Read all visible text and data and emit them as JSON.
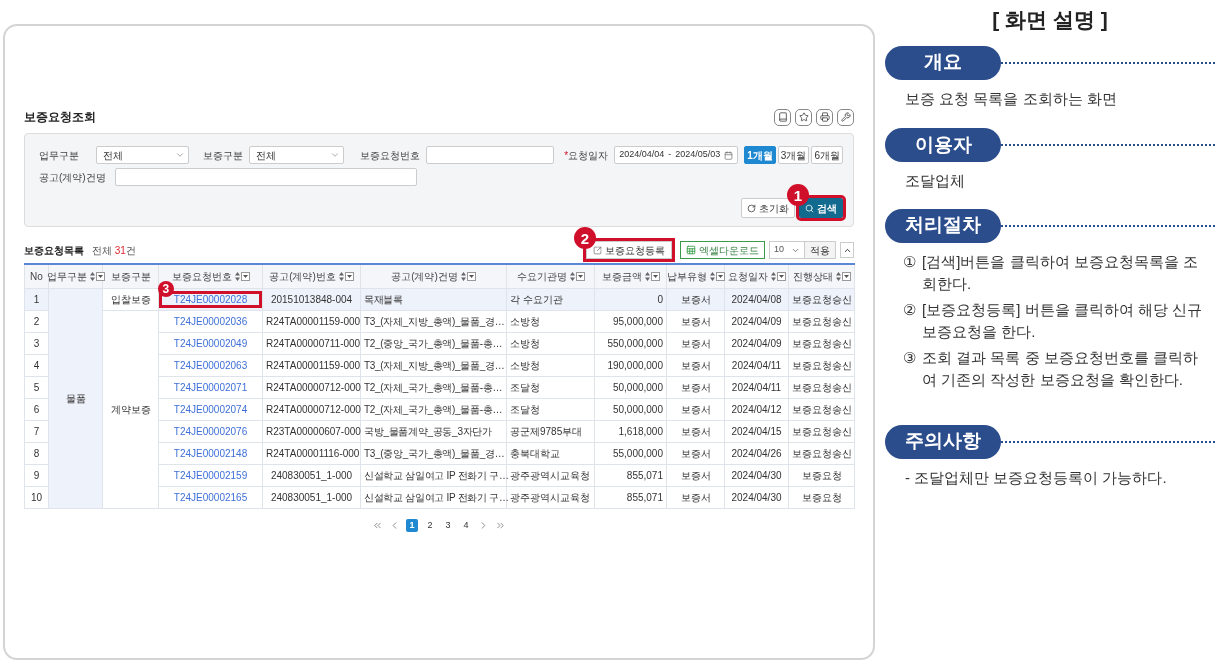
{
  "screen": {
    "title": "보증요청조회",
    "toolbar": [
      {
        "kind": "manual"
      },
      {
        "kind": "favorite"
      },
      {
        "kind": "print"
      },
      {
        "kind": "settings"
      }
    ],
    "filters": {
      "business": {
        "label": "업무구분",
        "value": "전체"
      },
      "guarantee": {
        "label": "보증구분",
        "value": "전체"
      },
      "request_no": {
        "label": "보증요청번호"
      },
      "date": {
        "required_mark": "*",
        "label": "요청일자",
        "from": "2024/04/04",
        "separator": "-",
        "to": "2024/05/03"
      },
      "periods": [
        {
          "label": "1개월",
          "selected": true
        },
        {
          "label": "3개월",
          "selected": false
        },
        {
          "label": "6개월",
          "selected": false
        }
      ],
      "notice_name": {
        "label": "공고(계약)건명"
      },
      "reset_button": "초기화",
      "search_button": {
        "label": "검색",
        "callout": "1"
      }
    },
    "list": {
      "title": "보증요청목록",
      "total_label": "전체",
      "total_count": "31",
      "total_unit": "건",
      "register_button": {
        "label": "보증요청등록",
        "callout": "2"
      },
      "excel_button": "엑셀다운로드",
      "page_size": "10",
      "apply_button": "적용"
    },
    "table": {
      "columns": [
        {
          "label": "No",
          "sortable": false
        },
        {
          "label": "업무구분",
          "sortable": true
        },
        {
          "label": "보증구분",
          "sortable": false
        },
        {
          "label": "보증요청번호",
          "sortable": true
        },
        {
          "label": "공고(계약)번호",
          "sortable": true
        },
        {
          "label": "공고(계약)건명",
          "sortable": true
        },
        {
          "label": "수요기관명",
          "sortable": true
        },
        {
          "label": "보증금액",
          "sortable": true
        },
        {
          "label": "납부유형",
          "sortable": true
        },
        {
          "label": "요청일자",
          "sortable": true
        },
        {
          "label": "진행상태",
          "sortable": true
        }
      ],
      "groups": [
        {
          "business": "물품",
          "subgroups": [
            {
              "guarantee": "입찰보증",
              "rows": [
                {
                  "no": "1",
                  "request_no": "T24JE00002028",
                  "callout": "3",
                  "notice_no": "20151013848-004",
                  "notice_name": "목재블록",
                  "agency": "각 수요기관",
                  "amount": "0",
                  "payment": "보증서",
                  "date": "2024/04/08",
                  "status": "보증요청승신",
                  "selected": true
                }
              ]
            },
            {
              "guarantee": "계약보증",
              "rows": [
                {
                  "no": "2",
                  "request_no": "T24JE00002036",
                  "notice_no": "R24TA00001159-000",
                  "notice_name": "T3_(자체_지방_총액)_물품_경…",
                  "agency": "소방청",
                  "amount": "95,000,000",
                  "payment": "보증서",
                  "date": "2024/04/09",
                  "status": "보증요청송신",
                  "selected": false
                },
                {
                  "no": "3",
                  "request_no": "T24JE00002049",
                  "notice_no": "R24TA00000711-000",
                  "notice_name": "T2_(중앙_국가_총액)_물품-총…",
                  "agency": "소방청",
                  "amount": "550,000,000",
                  "payment": "보증서",
                  "date": "2024/04/09",
                  "status": "보증요청송신",
                  "selected": false
                },
                {
                  "no": "4",
                  "request_no": "T24JE00002063",
                  "notice_no": "R24TA00001159-000",
                  "notice_name": "T3_(자체_지방_총액)_물품_경…",
                  "agency": "소방청",
                  "amount": "190,000,000",
                  "payment": "보증서",
                  "date": "2024/04/11",
                  "status": "보증요청송신",
                  "selected": false
                },
                {
                  "no": "5",
                  "request_no": "T24JE00002071",
                  "notice_no": "R24TA00000712-000",
                  "notice_name": "T2_(자체_국가_총액)_물품-총…",
                  "agency": "조달청",
                  "amount": "50,000,000",
                  "payment": "보증서",
                  "date": "2024/04/11",
                  "status": "보증요청송신",
                  "selected": false
                },
                {
                  "no": "6",
                  "request_no": "T24JE00002074",
                  "notice_no": "R24TA00000712-000",
                  "notice_name": "T2_(자체_국가_총액)_물품-총…",
                  "agency": "조달청",
                  "amount": "50,000,000",
                  "payment": "보증서",
                  "date": "2024/04/12",
                  "status": "보증요청송신",
                  "selected": false
                },
                {
                  "no": "7",
                  "request_no": "T24JE00002076",
                  "notice_no": "R23TA00000607-000",
                  "notice_name": "국방_물품계약_공동_3자단가",
                  "agency": "공군제9785부대",
                  "amount": "1,618,000",
                  "payment": "보증서",
                  "date": "2024/04/15",
                  "status": "보증요청송신",
                  "selected": false
                },
                {
                  "no": "8",
                  "request_no": "T24JE00002148",
                  "notice_no": "R24TA00001116-000",
                  "notice_name": "T3_(중앙_국가_총액)_물품_경…",
                  "agency": "충북대학교",
                  "amount": "55,000,000",
                  "payment": "보증서",
                  "date": "2024/04/26",
                  "status": "보증요청송신",
                  "selected": false
                },
                {
                  "no": "9",
                  "request_no": "T24JE00002159",
                  "notice_no": "240830051_1-000",
                  "notice_name": "신설학교 삼일여고 IP 전화기 구…",
                  "agency": "광주광역시교육청",
                  "amount": "855,071",
                  "payment": "보증서",
                  "date": "2024/04/30",
                  "status": "보증요청",
                  "selected": false
                },
                {
                  "no": "10",
                  "request_no": "T24JE00002165",
                  "notice_no": "240830051_1-000",
                  "notice_name": "신설학교 삼일여고 IP 전화기 구…",
                  "agency": "광주광역시교육청",
                  "amount": "855,071",
                  "payment": "보증서",
                  "date": "2024/04/30",
                  "status": "보증요청",
                  "selected": false
                }
              ]
            }
          ]
        }
      ]
    },
    "pagination": [
      {
        "label": "1",
        "selected": true
      },
      {
        "label": "2",
        "selected": false
      },
      {
        "label": "3",
        "selected": false
      },
      {
        "label": "4",
        "selected": false
      }
    ]
  },
  "guide": {
    "title": "[ 화면 설명 ]",
    "sections": [
      {
        "kind": "text",
        "heading": "개요",
        "text": "보증 요청 목록을 조회하는 화면"
      },
      {
        "kind": "text",
        "heading": "이용자",
        "text": "조달업체"
      },
      {
        "kind": "steps",
        "heading": "처리절차",
        "steps": [
          {
            "marker": "①",
            "text": "[검색]버튼을 클릭하여 보증요청목록을 조회한다."
          },
          {
            "marker": "②",
            "text": "[보증요청등록] 버튼을 클릭하여 해당 신규 보증요청을 한다."
          },
          {
            "marker": "③",
            "text": "조회 결과 목록 중 보증요청번호를 클릭하여 기존의 작성한 보증요청을 확인한다."
          }
        ]
      },
      {
        "kind": "text",
        "heading": "주의사항",
        "text": "- 조달업체만 보증요청등록이 가능하다."
      }
    ]
  }
}
